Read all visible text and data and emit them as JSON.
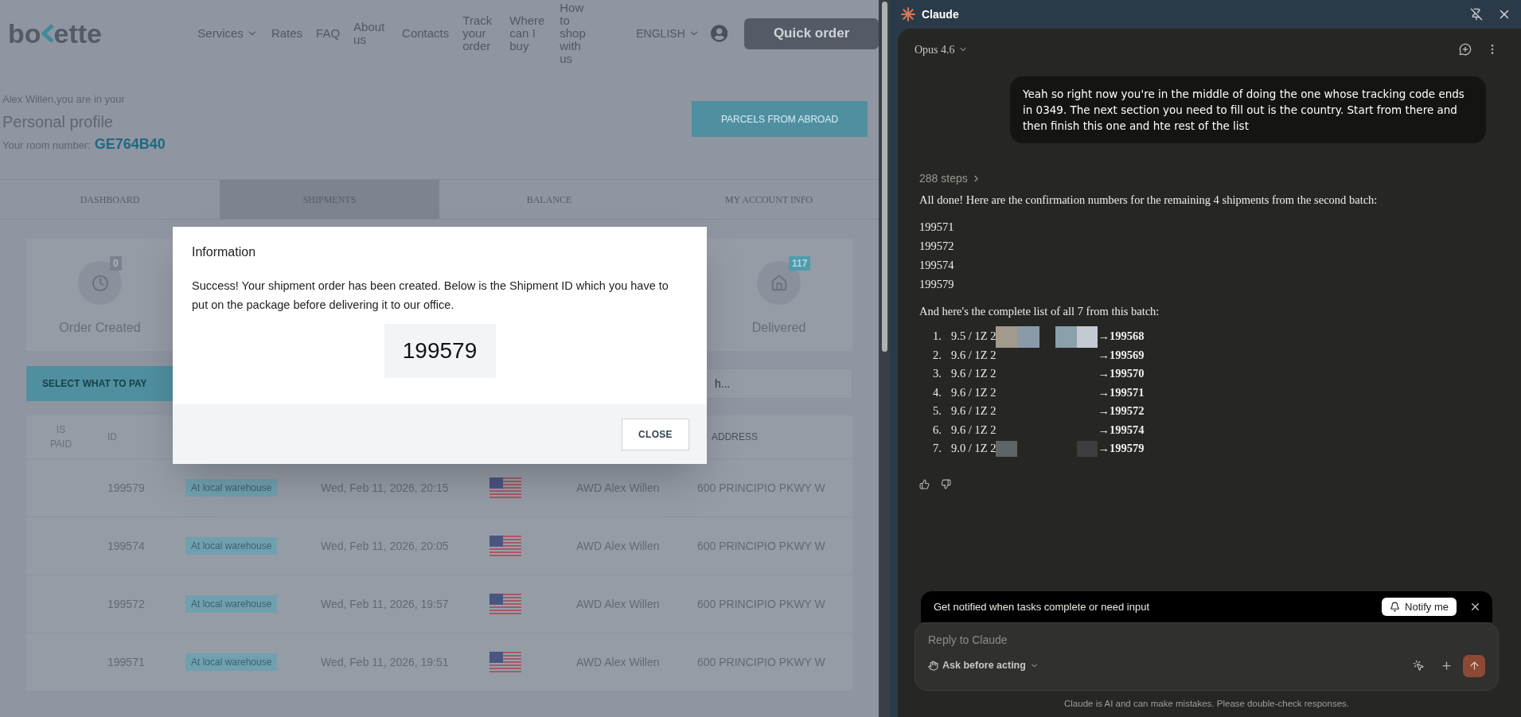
{
  "site": {
    "logo": {
      "left": "bo",
      "right": "ette"
    },
    "nav": [
      {
        "label": "Services",
        "dropdown": true
      },
      {
        "label": "Rates",
        "dropdown": false
      },
      {
        "label": "FAQ",
        "dropdown": false
      },
      {
        "label": "About us",
        "dropdown": false
      },
      {
        "label": "Contacts",
        "dropdown": false
      },
      {
        "label": "Track your order",
        "dropdown": false
      },
      {
        "label": "Where can I buy",
        "dropdown": false
      },
      {
        "label": "How to shop with us",
        "dropdown": false
      }
    ],
    "language": "ENGLISH",
    "quick_order": "Quick order",
    "profile": {
      "greeting": "Alex Willen,you are in your",
      "title": "Personal profile",
      "room_label": "Your room number:",
      "room_number": "GE764B40"
    },
    "parcels_button": "PARCELS FROM ABROAD",
    "tabs": [
      {
        "label": "DASHBOARD",
        "selected": false
      },
      {
        "label": "SHIPMENTS",
        "selected": true
      },
      {
        "label": "BALANCE",
        "selected": false
      },
      {
        "label": "MY ACCOUNT INFO",
        "selected": false
      }
    ],
    "status_cards": [
      {
        "kind": "clock",
        "label": "Order Created",
        "count": "0",
        "highlight": false
      },
      {
        "kind": "house",
        "label": "Delivered",
        "count": "117",
        "highlight": true
      }
    ],
    "select_button": "SELECT WHAT TO PAY",
    "search": {
      "placeholder": "h..."
    },
    "table": {
      "columns": [
        "IS PAID",
        "ID",
        "ADDRESS"
      ],
      "rows": [
        {
          "id": "199579",
          "status": "At local warehouse",
          "date": "Wed, Feb 11, 2026, 20:15",
          "recipient": "AWD Alex Willen",
          "address": "600 PRINCIPIO PKWY W"
        },
        {
          "id": "199574",
          "status": "At local warehouse",
          "date": "Wed, Feb 11, 2026, 20:05",
          "recipient": "AWD Alex Willen",
          "address": "600 PRINCIPIO PKWY W"
        },
        {
          "id": "199572",
          "status": "At local warehouse",
          "date": "Wed, Feb 11, 2026, 19:57",
          "recipient": "AWD Alex Willen",
          "address": "600 PRINCIPIO PKWY W"
        },
        {
          "id": "199571",
          "status": "At local warehouse",
          "date": "Wed, Feb 11, 2026, 19:51",
          "recipient": "AWD Alex Willen",
          "address": "600 PRINCIPIO PKWY W"
        }
      ]
    },
    "dialog": {
      "title": "Information",
      "message": "Success! Your shipment order has been created. Below is the Shipment ID which you have to put on the package before delivering it to our office.",
      "shipment_id": "199579",
      "close": "CLOSE"
    }
  },
  "assistant": {
    "title": "Claude",
    "model": "Opus 4.6",
    "user_message": "Yeah so right now you're in the middle of doing the one whose tracking code ends in 0349. The next section you need to fill out is the country. Start from there and then finish this one and hte rest of the list",
    "steps": "288 steps",
    "intro": "All done! Here are the confirmation numbers for the remaining 4 shipments from the second batch:",
    "numbers": [
      "199571",
      "199572",
      "199574",
      "199579"
    ],
    "list_intro": "And here's the complete list of all 7 from this batch:",
    "list": [
      {
        "marker": "1.",
        "prefix": "9.5 / 1Z 2",
        "result": "→199568",
        "kind": "light"
      },
      {
        "marker": "2.",
        "prefix": "9.6 / 1Z 2",
        "result": "→199569",
        "kind": "plain"
      },
      {
        "marker": "3.",
        "prefix": "9.6 / 1Z 2",
        "result": "→199570",
        "kind": "plain"
      },
      {
        "marker": "4.",
        "prefix": "9.6 / 1Z 2",
        "result": "→199571",
        "kind": "plain"
      },
      {
        "marker": "5.",
        "prefix": "9.6 / 1Z 2",
        "result": "→199572",
        "kind": "plain"
      },
      {
        "marker": "6.",
        "prefix": "9.6 / 1Z 2",
        "result": "→199574",
        "kind": "plain"
      },
      {
        "marker": "7.",
        "prefix": "9.0 / 1Z 2",
        "result": "→199579",
        "kind": "dark"
      }
    ],
    "notify": {
      "text": "Get notified when tasks complete or need input",
      "button": "Notify me"
    },
    "input": {
      "placeholder": "Reply to Claude"
    },
    "mode": "Ask before acting",
    "disclaimer": "Claude is AI and can make mistakes. Please double-check responses."
  }
}
